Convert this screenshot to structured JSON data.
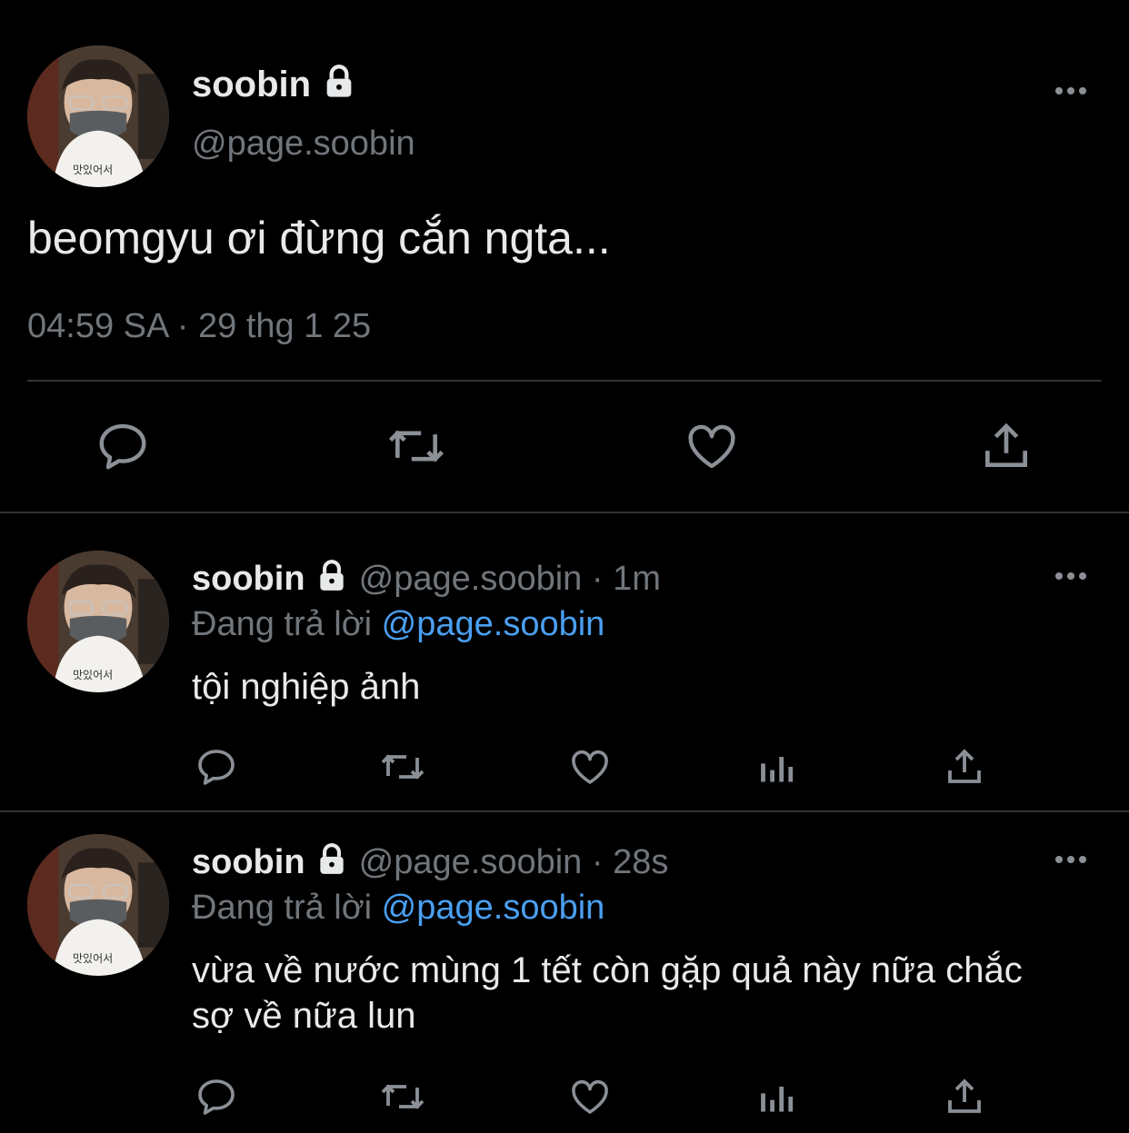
{
  "main_tweet": {
    "display_name": "soobin",
    "handle": "@page.soobin",
    "text": "beomgyu ơi đừng cắn ngta...",
    "timestamp": "04:59 SA · 29 thg 1 25",
    "avatar_caption": "맛있어서"
  },
  "replies": [
    {
      "display_name": "soobin",
      "handle_time": "@page.soobin · 1m",
      "replying_prefix": "Đang trả lời",
      "replying_to": "@page.soobin",
      "text_lines": [
        "tội nghiệp ảnh"
      ],
      "avatar_caption": "맛있어서"
    },
    {
      "display_name": "soobin",
      "handle_time": "@page.soobin · 28s",
      "replying_prefix": "Đang trả lời",
      "replying_to": "@page.soobin",
      "text_lines": [
        "vừa về nước mùng 1 tết còn gặp quả này nữa chắc",
        "sợ về nữa lun"
      ],
      "avatar_caption": "맛있어서"
    }
  ],
  "icons": [
    "lock-icon",
    "more-icon",
    "reply-icon",
    "retweet-icon",
    "like-icon",
    "views-icon",
    "share-icon"
  ],
  "colors": {
    "background": "#000000",
    "text": "#e7e9ea",
    "muted": "#71767b",
    "link": "#4a9ff0",
    "icon": "#8b9096"
  }
}
